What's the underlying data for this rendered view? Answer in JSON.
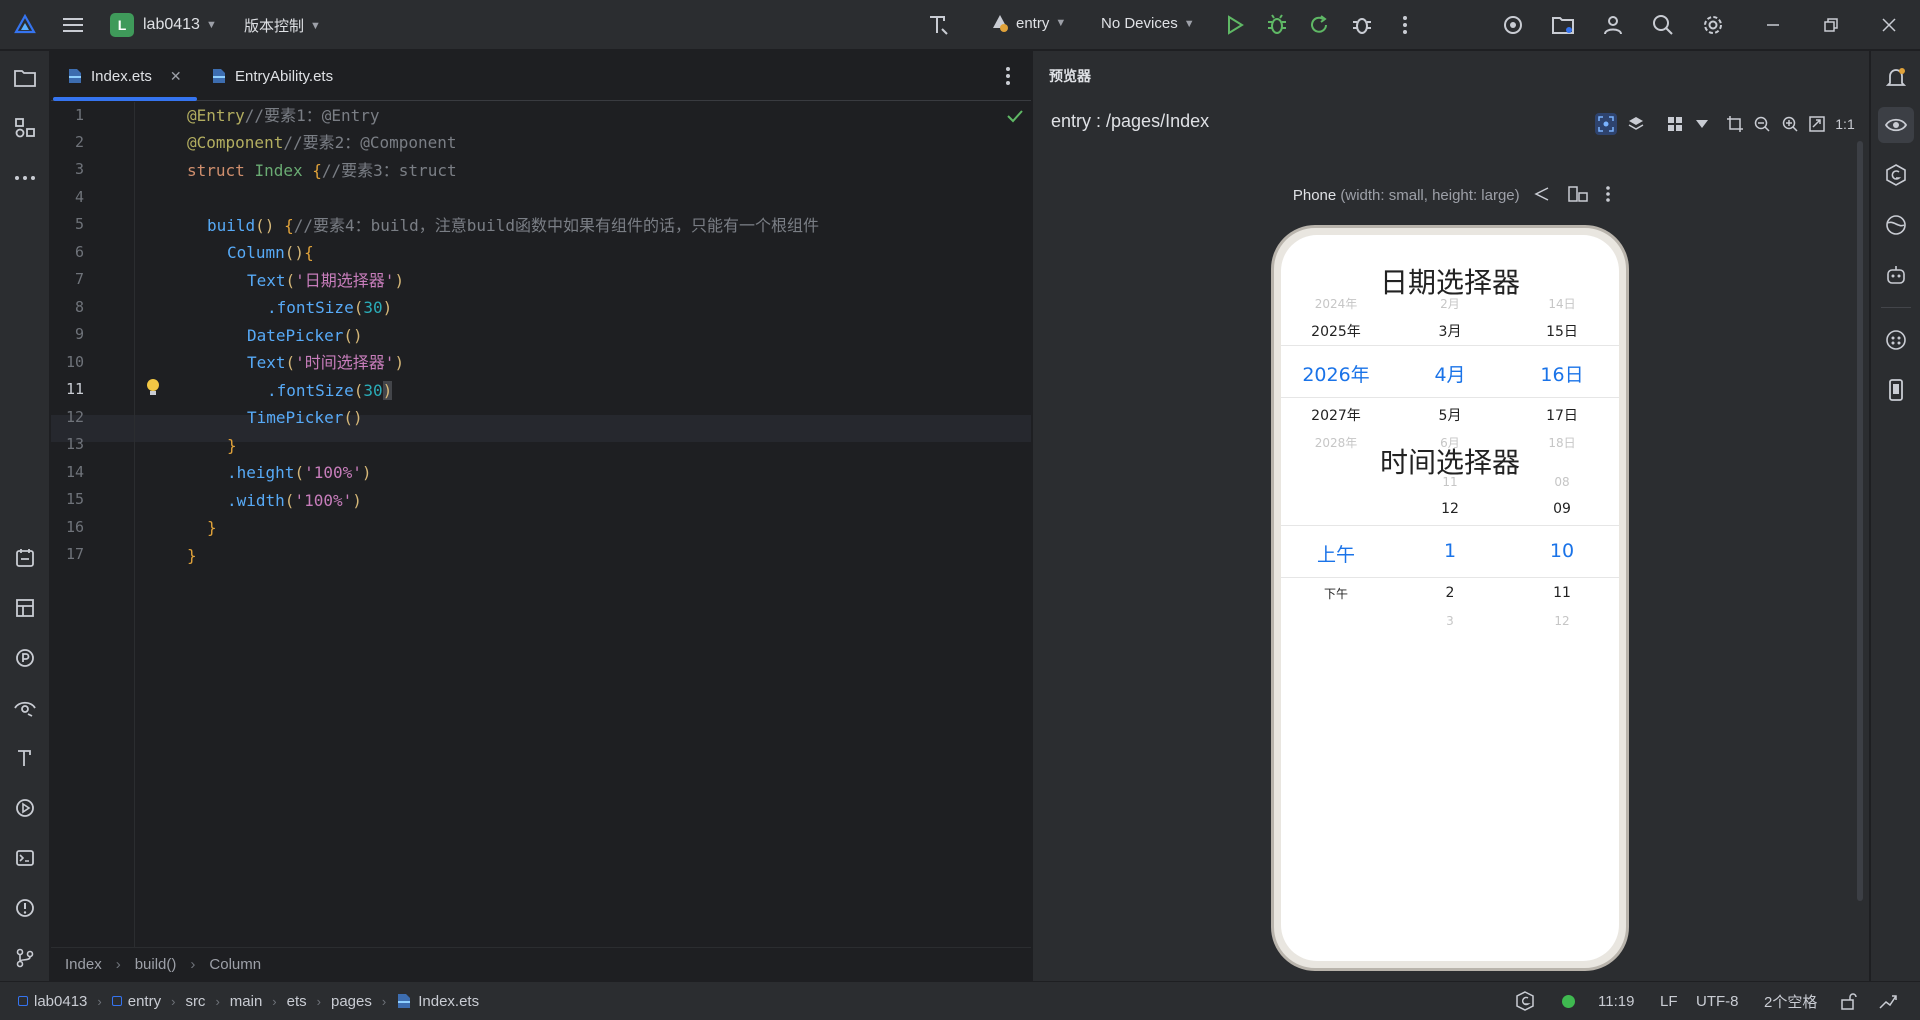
{
  "titlebar": {
    "project_initial": "L",
    "project_name": "lab0413",
    "vcs_label": "版本控制",
    "run_config": "entry",
    "device": "No Devices"
  },
  "editor": {
    "tabs": [
      {
        "label": "Index.ets",
        "active": true
      },
      {
        "label": "EntryAbility.ets",
        "active": false
      }
    ],
    "line_numbers": [
      "1",
      "2",
      "3",
      "4",
      "5",
      "6",
      "7",
      "8",
      "9",
      "10",
      "11",
      "12",
      "13",
      "14",
      "15",
      "16",
      "17"
    ],
    "current_line": "11",
    "code": {
      "l1_dec": "@Entry",
      "l1_cmt": "//要素1：@Entry",
      "l2_dec": "@Component",
      "l2_cmt": "//要素2：@Component",
      "l3_kw": "struct",
      "l3_name": "Index",
      "l3_brace": "{",
      "l3_cmt": "//要素3：struct",
      "l5_fn": "build",
      "l5_paren": "()",
      "l5_brace": "{",
      "l5_cmt": "//要素4：build，注意build函数中如果有组件的话，只能有一个根组件",
      "l6_fn": "Column",
      "l6_paren": "()",
      "l6_brace": "{",
      "l7_fn": "Text",
      "l7_open": "(",
      "l7_str": "'日期选择器'",
      "l7_close": ")",
      "l8_fn": ".fontSize",
      "l8_open": "(",
      "l8_num": "30",
      "l8_close": ")",
      "l9_fn": "DatePicker",
      "l9_paren": "()",
      "l10_fn": "Text",
      "l10_open": "(",
      "l10_str": "'时间选择器'",
      "l10_close": ")",
      "l11_fn": ".fontSize",
      "l11_open": "(",
      "l11_num": "30",
      "l11_close": ")",
      "l12_fn": "TimePicker",
      "l12_paren": "()",
      "l13_brace": "}",
      "l14_fn": ".height",
      "l14_open": "(",
      "l14_str": "'100%'",
      "l14_close": ")",
      "l15_fn": ".width",
      "l15_open": "(",
      "l15_str": "'100%'",
      "l15_close": ")",
      "l16_brace": "}",
      "l17_brace": "}"
    },
    "breadcrumb": [
      "Index",
      "build()",
      "Column"
    ]
  },
  "preview": {
    "panel_title": "预览器",
    "path": "entry : /pages/Index",
    "zoom_label": "1:1",
    "device_name": "Phone",
    "device_desc": "(width: small, height: large)",
    "phone": {
      "date_title": "日期选择器",
      "date_rows": [
        {
          "year": "2024年",
          "month": "2月",
          "day": "14日"
        },
        {
          "year": "2025年",
          "month": "3月",
          "day": "15日"
        },
        {
          "year": "2026年",
          "month": "4月",
          "day": "16日"
        },
        {
          "year": "2027年",
          "month": "5月",
          "day": "17日"
        },
        {
          "year": "2028年",
          "month": "6月",
          "day": "18日"
        }
      ],
      "time_title": "时间选择器",
      "time_rows": [
        {
          "period": "",
          "hour": "11",
          "minute": "08"
        },
        {
          "period": "",
          "hour": "12",
          "minute": "09"
        },
        {
          "period": "上午",
          "hour": "1",
          "minute": "10"
        },
        {
          "period": "下午",
          "hour": "2",
          "minute": "11"
        },
        {
          "period": "",
          "hour": "3",
          "minute": "12"
        }
      ]
    }
  },
  "statusbar": {
    "path": [
      "lab0413",
      "entry",
      "src",
      "main",
      "ets",
      "pages",
      "Index.ets"
    ],
    "position": "11:19",
    "line_ending": "LF",
    "encoding": "UTF-8",
    "indent": "2个空格"
  },
  "colors": {
    "accent": "#3574f0",
    "picker_selected": "#1a73e8",
    "run_green": "#5fb865",
    "status_dot": "#3fb950"
  }
}
